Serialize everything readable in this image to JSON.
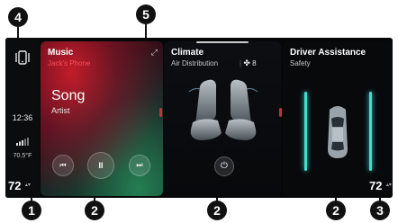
{
  "callouts": [
    "1",
    "2",
    "2",
    "2",
    "3",
    "4",
    "5"
  ],
  "sidebar": {
    "time": "12:36",
    "outside_temp": "70.5°F",
    "left_temp": "72",
    "right_temp": "72"
  },
  "music": {
    "title": "Music",
    "source": "Jack's Phone",
    "song": "Song",
    "artist": "Artist",
    "prev_symbol": "⏮",
    "pause_symbol": "II",
    "next_symbol": "⏭",
    "expand_symbol": "⤢"
  },
  "climate": {
    "title": "Climate",
    "mode": "Air Distribution",
    "fan_symbol": "✤",
    "fan_level": "8",
    "power_symbol": "⏻"
  },
  "driver": {
    "title": "Driver Assistance",
    "subtitle": "Safety"
  },
  "colors": {
    "accent_red": "#d12a3a",
    "teal_glow": "#3fe0d0"
  }
}
